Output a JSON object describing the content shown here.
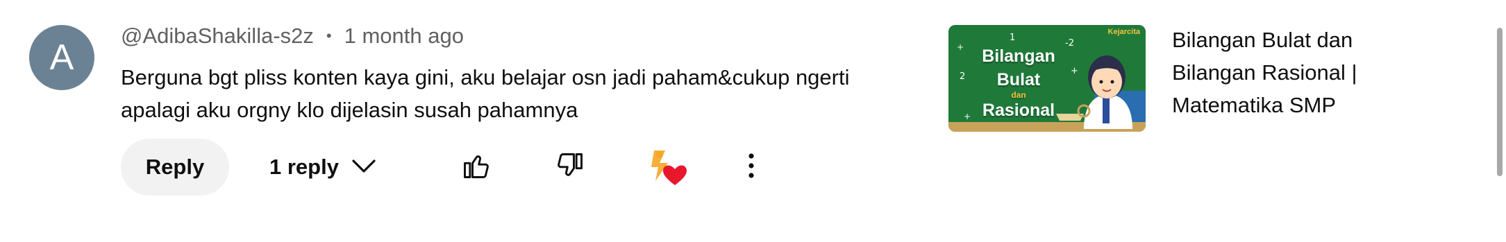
{
  "comment": {
    "avatar_letter": "A",
    "author": "@AdibaShakilla-s2z",
    "separator": "•",
    "time": "1 month ago",
    "text_line1": "Berguna bgt pliss konten kaya gini, aku belajar osn jadi paham&cukup ngerti",
    "text_line2": "apalagi aku orgny klo dijelasin susah pahamnya"
  },
  "actions": {
    "reply_label": "Reply",
    "replies_label": "1 reply",
    "icons": [
      "like-icon",
      "dislike-icon",
      "creator-heart-icon",
      "more-options-icon"
    ]
  },
  "video": {
    "thumbnail_title_line1": "Bilangan",
    "thumbnail_title_line2": "Bulat",
    "thumbnail_title_and": "dan",
    "thumbnail_title_line3": "Rasional",
    "thumbnail_brand": "Kejarcita",
    "title_line1": "Bilangan Bulat dan",
    "title_line2": "Bilangan Rasional |",
    "title_line3": "Matematika SMP"
  },
  "colors": {
    "avatar_bg": "#6b8294",
    "thumbnail_bg": "#1f7a3a",
    "heart": "#e8172c",
    "badge": "#f5a623"
  }
}
